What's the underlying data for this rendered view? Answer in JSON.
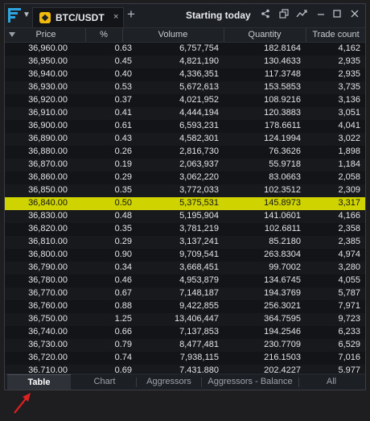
{
  "header": {
    "tab_title": "BTC/USDT",
    "tab_close": "×",
    "add_tab": "+",
    "window_title": "Starting today",
    "chevron": "v",
    "icons": [
      "share-icon",
      "detach-icon",
      "chart-link-icon",
      "minimize-icon",
      "maximize-icon",
      "close-icon"
    ]
  },
  "table": {
    "columns": [
      "Price",
      "%",
      "Volume",
      "Quantity",
      "Trade count"
    ],
    "rows": [
      [
        "36,960.00",
        "0.63",
        "6,757,754",
        "182.8164",
        "4,162"
      ],
      [
        "36,950.00",
        "0.45",
        "4,821,190",
        "130.4633",
        "2,935"
      ],
      [
        "36,940.00",
        "0.40",
        "4,336,351",
        "117.3748",
        "2,935"
      ],
      [
        "36,930.00",
        "0.53",
        "5,672,613",
        "153.5853",
        "3,735"
      ],
      [
        "36,920.00",
        "0.37",
        "4,021,952",
        "108.9216",
        "3,136"
      ],
      [
        "36,910.00",
        "0.41",
        "4,444,194",
        "120.3883",
        "3,051"
      ],
      [
        "36,900.00",
        "0.61",
        "6,593,231",
        "178.6611",
        "4,041"
      ],
      [
        "36,890.00",
        "0.43",
        "4,582,301",
        "124.1994",
        "3,022"
      ],
      [
        "36,880.00",
        "0.26",
        "2,816,730",
        "76.3626",
        "1,898"
      ],
      [
        "36,870.00",
        "0.19",
        "2,063,937",
        "55.9718",
        "1,184"
      ],
      [
        "36,860.00",
        "0.29",
        "3,062,220",
        "83.0663",
        "2,058"
      ],
      [
        "36,850.00",
        "0.35",
        "3,772,033",
        "102.3512",
        "2,309"
      ],
      [
        "36,840.00",
        "0.50",
        "5,375,531",
        "145.8973",
        "3,317"
      ],
      [
        "36,830.00",
        "0.48",
        "5,195,904",
        "141.0601",
        "4,166"
      ],
      [
        "36,820.00",
        "0.35",
        "3,781,219",
        "102.6811",
        "2,358"
      ],
      [
        "36,810.00",
        "0.29",
        "3,137,241",
        "85.2180",
        "2,385"
      ],
      [
        "36,800.00",
        "0.90",
        "9,709,541",
        "263.8304",
        "4,974"
      ],
      [
        "36,790.00",
        "0.34",
        "3,668,451",
        "99.7002",
        "3,280"
      ],
      [
        "36,780.00",
        "0.46",
        "4,953,879",
        "134.6745",
        "4,055"
      ],
      [
        "36,770.00",
        "0.67",
        "7,148,187",
        "194.3769",
        "5,787"
      ],
      [
        "36,760.00",
        "0.88",
        "9,422,855",
        "256.3021",
        "7,971"
      ],
      [
        "36,750.00",
        "1.25",
        "13,406,447",
        "364.7595",
        "9,723"
      ],
      [
        "36,740.00",
        "0.66",
        "7,137,853",
        "194.2546",
        "6,233"
      ],
      [
        "36,730.00",
        "0.79",
        "8,477,481",
        "230.7709",
        "6,529"
      ],
      [
        "36,720.00",
        "0.74",
        "7,938,115",
        "216.1503",
        "7,016"
      ],
      [
        "36,710.00",
        "0.69",
        "7,431,880",
        "202.4227",
        "5,977"
      ]
    ],
    "highlighted_index": 12,
    "highlight_color": "#cfd400"
  },
  "bottom_tabs": [
    "Table",
    "Chart",
    "Aggressors",
    "Aggressors - Balance",
    "All"
  ],
  "active_tab": "Table",
  "colors": {
    "accent": "#2fa5e0",
    "annotation": "#e02020"
  }
}
